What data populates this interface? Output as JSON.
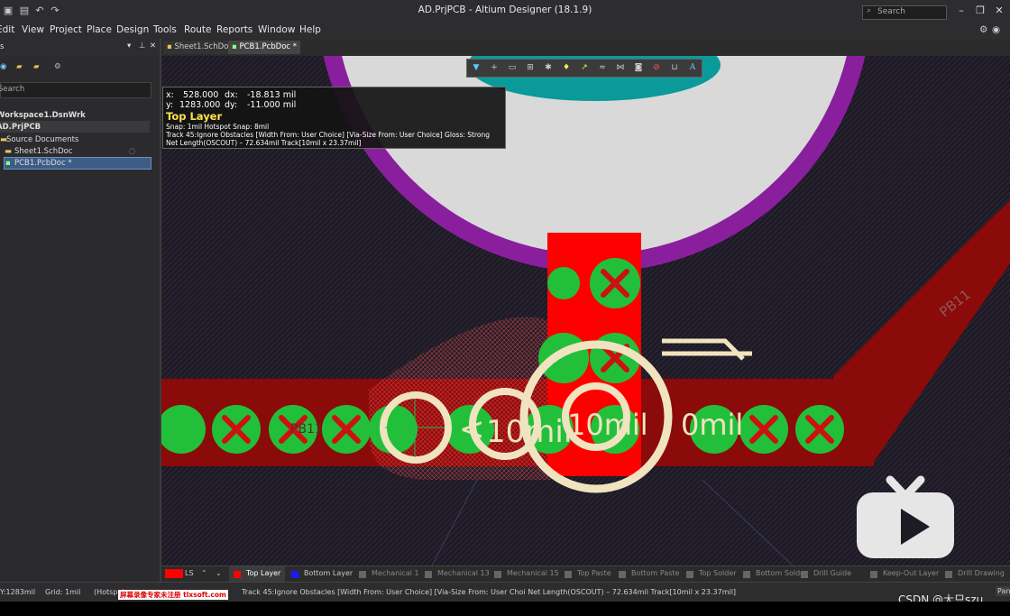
{
  "window": {
    "title": "AD.PrjPCB - Altium Designer (18.1.9)",
    "search_placeholder": "Search"
  },
  "menu": [
    "Edit",
    "View",
    "Project",
    "Place",
    "Design",
    "Tools",
    "Route",
    "Reports",
    "Window",
    "Help"
  ],
  "left_panel": {
    "search_label": "Search",
    "tree": {
      "workspace": "Workspace1.DsnWrk",
      "project": "AD.PrjPCB",
      "folder": "Source Documents",
      "doc1": "Sheet1.SchDoc",
      "doc2": "PCB1.PcbDoc *"
    },
    "header_glyph": "s"
  },
  "doc_tabs": [
    {
      "label": "Sheet1.SchDoc",
      "active": false
    },
    {
      "label": "PCB1.PcbDoc *",
      "active": true
    }
  ],
  "hud": {
    "x_label": "x:",
    "x_value": "528.000",
    "dx_label": "dx:",
    "dx_value": "-18.813 mil",
    "y_label": "y:",
    "y_value": "1283.000",
    "dy_label": "dy:",
    "dy_value": "-11.000 mil",
    "layer": "Top Layer",
    "snap": "Snap: 1mil Hotspot Snap: 8mil",
    "track": "Track 45:Ignore Obstacles [Width From: User Choice] [Via-Size From: User Choice] Gloss: Strong",
    "net": "Net Length(OSCOUT) – 72.634mil Track[10mil x 23.37mil]"
  },
  "canvas_labels": {
    "pb11_left": "PB11",
    "pb11_right": "PB11",
    "mil_a": "10mil",
    "mil_b": "10mil",
    "mil_c": "0mil",
    "lt": "<"
  },
  "layers": [
    {
      "name": "Top Layer",
      "color": "#ff0000",
      "active": true
    },
    {
      "name": "Bottom Layer",
      "color": "#1a1aff",
      "active": false
    },
    {
      "name": "Mechanical 1",
      "color": "#666666",
      "active": false
    },
    {
      "name": "Mechanical 13",
      "color": "#666666",
      "active": false
    },
    {
      "name": "Mechanical 15",
      "color": "#666666",
      "active": false
    },
    {
      "name": "Top Paste",
      "color": "#666666",
      "active": false
    },
    {
      "name": "Bottom Paste",
      "color": "#666666",
      "active": false
    },
    {
      "name": "Top Solder",
      "color": "#666666",
      "active": false
    },
    {
      "name": "Bottom Solder",
      "color": "#666666",
      "active": false
    },
    {
      "name": "Drill Guide",
      "color": "#666666",
      "active": false
    },
    {
      "name": "Keep-Out Layer",
      "color": "#666666",
      "active": false
    },
    {
      "name": "Drill Drawing",
      "color": "#666666",
      "active": false
    }
  ],
  "layer_set_label": "LS",
  "status": {
    "coords": "Y:1283mil",
    "grid": "Grid: 1mil",
    "hotspot": "(Hotspot",
    "watermark": "屏幕录像专家未注册 tlxsoft.com",
    "message": "Track 45:Ignore Obstacles [Width From: User Choice] [Via-Size From: User Choi  Net Length(OSCOUT) – 72.634mil Track[10mil x 23.37mil]",
    "panels_btn": "Pan"
  },
  "footer": {
    "csdn": "CSDN @大只szu"
  },
  "colors": {
    "board_bg": "#1e1b24",
    "copper_top": "#ff0000",
    "copper_dark": "#8b0a0a",
    "pad_green": "#22c03a",
    "pad_x": "#c11",
    "silk": "#f0e3bf",
    "purple": "#8a1f9e",
    "teal": "#0a9a9a",
    "grey_pad": "#d9d9d9"
  }
}
